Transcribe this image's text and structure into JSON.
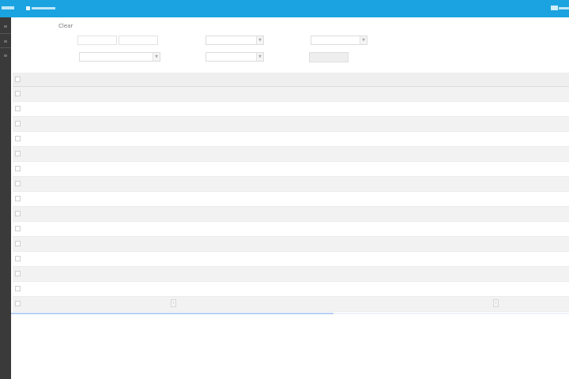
{
  "topbar": {
    "app_label": "",
    "nav_label": "",
    "accent": "#1aa3e0"
  },
  "sidebar": {
    "background": "#3a3a3a"
  },
  "filters": {
    "clear_label": "Clear",
    "row1": [
      {
        "label": "",
        "input_value": "",
        "input2_value": ""
      },
      {
        "label": "",
        "select_value": ""
      },
      {
        "label": "",
        "select_value": ""
      }
    ],
    "row2": [
      {
        "label": "",
        "select_value": ""
      },
      {
        "label": "",
        "select_value": ""
      }
    ],
    "search_label": ""
  },
  "table": {
    "columns": [
      "",
      "",
      "",
      "",
      "",
      "",
      ""
    ],
    "rows": [
      [
        "",
        "",
        "",
        "",
        "",
        "",
        ""
      ],
      [
        "",
        "",
        "",
        "",
        "",
        "",
        ""
      ],
      [
        "",
        "",
        "",
        "",
        "",
        "",
        ""
      ],
      [
        "",
        "",
        "",
        "",
        "",
        "",
        ""
      ],
      [
        "",
        "",
        "",
        "",
        "",
        "",
        ""
      ],
      [
        "",
        "",
        "",
        "",
        "",
        "",
        ""
      ],
      [
        "",
        "",
        "",
        "",
        "",
        "",
        ""
      ],
      [
        "",
        "",
        "",
        "",
        "",
        "",
        ""
      ],
      [
        "",
        "",
        "",
        "",
        "",
        "",
        ""
      ],
      [
        "",
        "",
        "",
        "",
        "",
        "",
        ""
      ],
      [
        "",
        "",
        "",
        "",
        "",
        "",
        ""
      ],
      [
        "",
        "",
        "",
        "",
        "",
        "",
        ""
      ],
      [
        "",
        "",
        "",
        "",
        "",
        "",
        ""
      ],
      [
        "",
        "",
        "",
        "",
        "",
        "",
        ""
      ],
      [
        "",
        "",
        "",
        "",
        "",
        "",
        ""
      ]
    ]
  },
  "pager": {
    "prev_label": "‹",
    "next_label": "›"
  }
}
